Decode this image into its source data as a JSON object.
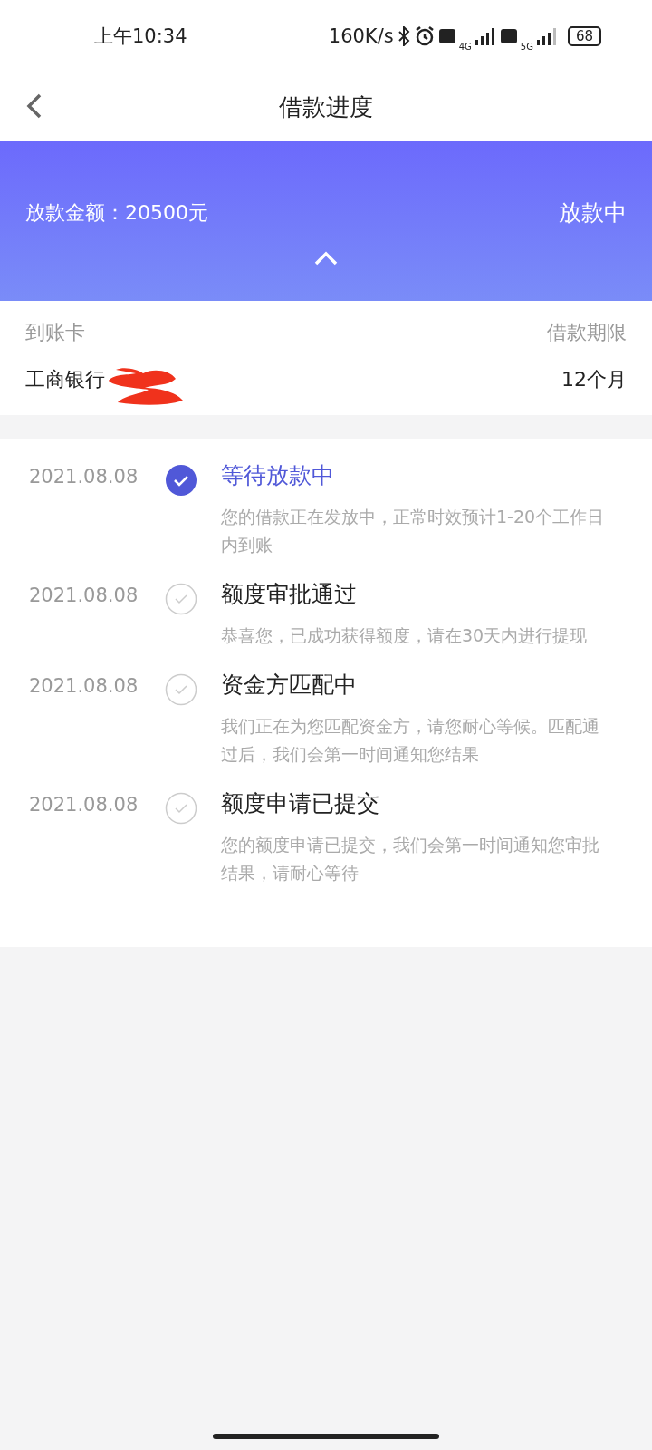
{
  "status_bar": {
    "time": "上午10:34",
    "speed": "160K/s",
    "network_1": "4G",
    "network_2": "5G",
    "battery": "68"
  },
  "header": {
    "title": "借款进度"
  },
  "banner": {
    "amount": "放款金额：20500元",
    "status": "放款中"
  },
  "card_info": {
    "card_label": "到账卡",
    "term_label": "借款期限",
    "bank": "工商银行",
    "term": "12个月"
  },
  "steps": [
    {
      "date": "2021.08.08",
      "title": "等待放款中",
      "desc": "您的借款正在发放中，正常时效预计1-20个工作日内到账",
      "current": true
    },
    {
      "date": "2021.08.08",
      "title": "额度审批通过",
      "desc": "恭喜您，已成功获得额度，请在30天内进行提现",
      "current": false
    },
    {
      "date": "2021.08.08",
      "title": "资金方匹配中",
      "desc": "我们正在为您匹配资金方，请您耐心等候。匹配通过后，我们会第一时间通知您结果",
      "current": false
    },
    {
      "date": "2021.08.08",
      "title": "额度申请已提交",
      "desc": "您的额度申请已提交，我们会第一时间通知您审批结果，请耐心等待",
      "current": false
    }
  ]
}
